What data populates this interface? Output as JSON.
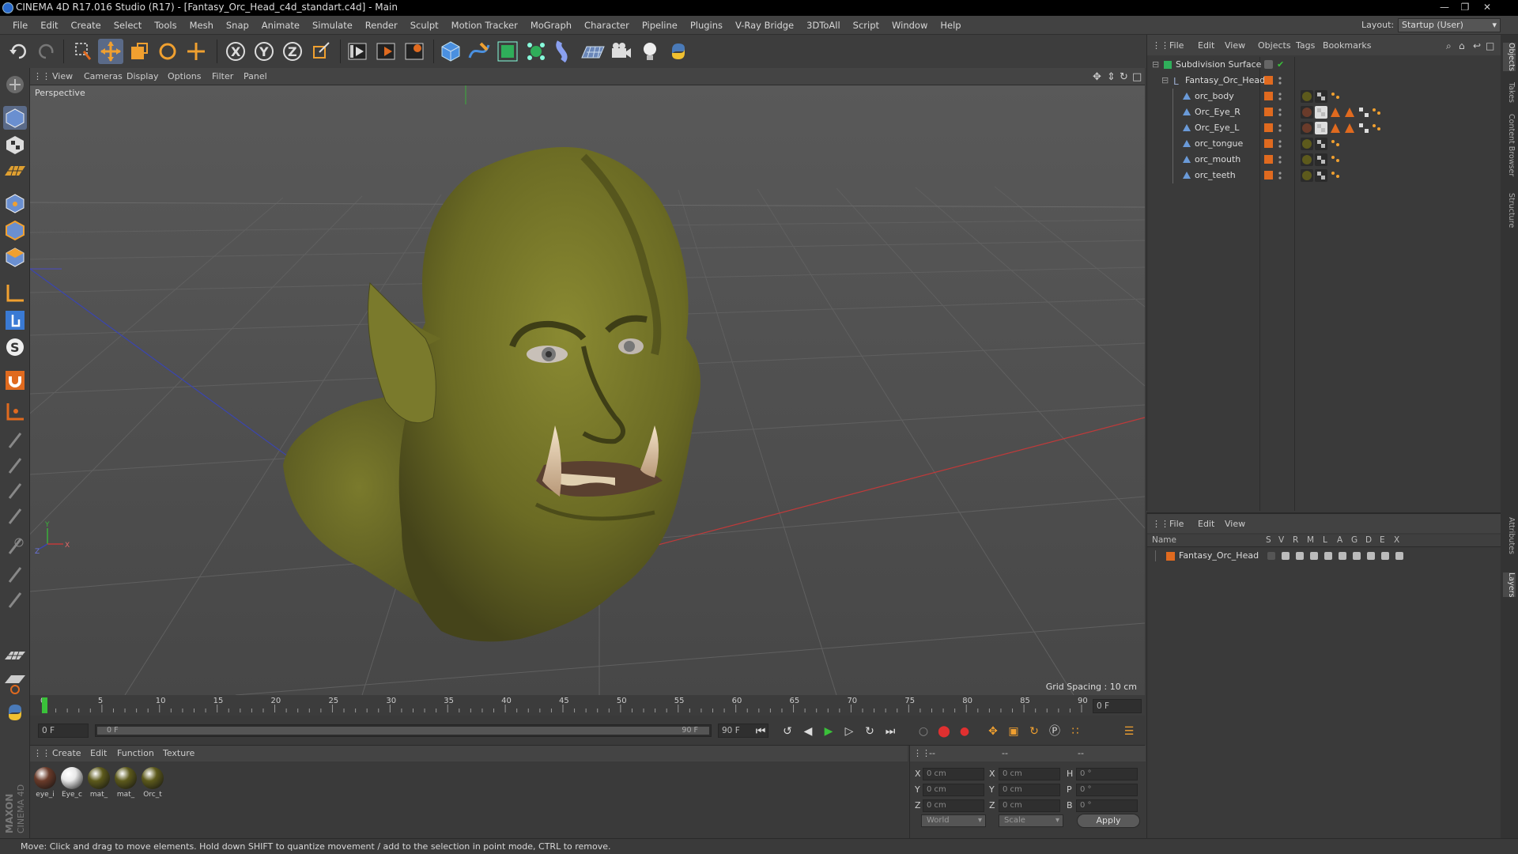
{
  "window": {
    "title": "CINEMA 4D R17.016 Studio (R17) - [Fantasy_Orc_Head_c4d_standart.c4d] - Main"
  },
  "menubar": {
    "items": [
      "File",
      "Edit",
      "Create",
      "Select",
      "Tools",
      "Mesh",
      "Snap",
      "Animate",
      "Simulate",
      "Render",
      "Sculpt",
      "Motion Tracker",
      "MoGraph",
      "Character",
      "Pipeline",
      "Plugins",
      "V-Ray Bridge",
      "3DToAll",
      "Script",
      "Window",
      "Help"
    ],
    "layout_label": "Layout:",
    "layout_value": "Startup (User)"
  },
  "viewport": {
    "menu": [
      "View",
      "Cameras",
      "Display",
      "Options",
      "Filter",
      "Panel"
    ],
    "camera_label": "Perspective",
    "grid_spacing": "Grid Spacing : 10 cm",
    "axis_labels": {
      "y": "Y",
      "z": "Z",
      "x": "X"
    }
  },
  "timeline": {
    "ticks": [
      "0",
      "5",
      "10",
      "15",
      "20",
      "25",
      "30",
      "35",
      "40",
      "45",
      "50",
      "55",
      "60",
      "65",
      "70",
      "75",
      "80",
      "85",
      "90"
    ],
    "current_frame_field": "0 F",
    "current_frame": 0,
    "max_frame": 90
  },
  "playbar": {
    "start_field": "0 F",
    "range_start": "0 F",
    "range_end": "90 F",
    "end_field": "90 F"
  },
  "materials": {
    "menu": [
      "Create",
      "Edit",
      "Function",
      "Texture"
    ],
    "items": [
      {
        "label": "eye_i",
        "color": "#6a3b2a"
      },
      {
        "label": "Eye_c",
        "color": "#e8e8e8"
      },
      {
        "label": "mat_",
        "color": "#5d5a1c"
      },
      {
        "label": "mat_",
        "color": "#5d5a1c"
      },
      {
        "label": "Orc_t",
        "color": "#5d5a1c"
      }
    ]
  },
  "coordinates": {
    "header": [
      "--",
      "--",
      "--"
    ],
    "rows": [
      {
        "a": "X",
        "av": "0 cm",
        "b": "X",
        "bv": "0 cm",
        "c": "H",
        "cv": "0 °"
      },
      {
        "a": "Y",
        "av": "0 cm",
        "b": "Y",
        "bv": "0 cm",
        "c": "P",
        "cv": "0 °"
      },
      {
        "a": "Z",
        "av": "0 cm",
        "b": "Z",
        "bv": "0 cm",
        "c": "B",
        "cv": "0 °"
      }
    ],
    "space": "World",
    "mode": "Scale",
    "apply_label": "Apply"
  },
  "objects": {
    "menu": [
      "File",
      "Edit",
      "View",
      "Objects",
      "Tags",
      "Bookmarks"
    ],
    "tree": [
      {
        "name": "Subdivision Surface",
        "indent": 0
      },
      {
        "name": "Fantasy_Orc_Head",
        "indent": 1
      },
      {
        "name": "orc_body",
        "indent": 2
      },
      {
        "name": "Orc_Eye_R",
        "indent": 2
      },
      {
        "name": "Orc_Eye_L",
        "indent": 2
      },
      {
        "name": "orc_tongue",
        "indent": 2
      },
      {
        "name": "orc_mouth",
        "indent": 2
      },
      {
        "name": "orc_teeth",
        "indent": 2
      }
    ]
  },
  "layers": {
    "menu": [
      "File",
      "Edit",
      "View"
    ],
    "columns": [
      "Name",
      "S",
      "V",
      "R",
      "M",
      "L",
      "A",
      "G",
      "D",
      "E",
      "X"
    ],
    "rows": [
      {
        "name": "Fantasy_Orc_Head",
        "color": "#e06a1f"
      }
    ]
  },
  "sidetabs": [
    "Objects",
    "Takes",
    "Content Browser",
    "Structure",
    "Attributes",
    "Layers"
  ],
  "status": {
    "text": "Move: Click and drag to move elements. Hold down SHIFT to quantize movement / add to the selection in point mode, CTRL to remove."
  },
  "branding": {
    "logo_text": "MAXON CINEMA 4D"
  },
  "colors": {
    "accent_blue": "#3a7ad4",
    "object_orange": "#e06a1f",
    "orc_skin": "#7a7a2a",
    "play_green": "#3ac13a"
  }
}
